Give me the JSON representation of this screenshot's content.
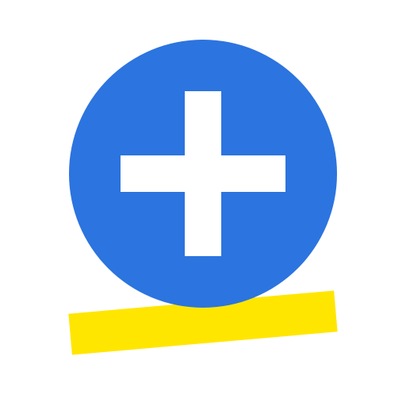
{
  "icon": {
    "name": "add-plus-icon",
    "circle_color": "#2C74DF",
    "highlight_color": "#FFE600",
    "glyph_color": "#FFFFFF"
  }
}
